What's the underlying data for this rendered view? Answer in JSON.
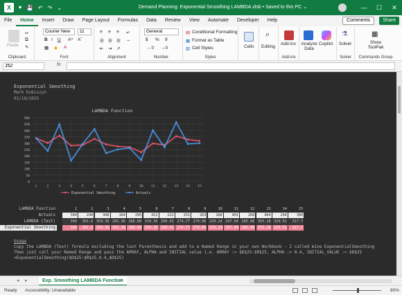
{
  "app": {
    "logo": "X",
    "title": "Demand Planning: Exponential Smoothing LAMBDA.xlsb  •  Saved to this PC",
    "title_short": "Demand Planning: Exponential Smoothing LAMBDA.xlsb • Saved to this PC ⌄"
  },
  "menu": {
    "tabs": [
      "File",
      "Home",
      "Insert",
      "Draw",
      "Page Layout",
      "Formulas",
      "Data",
      "Review",
      "View",
      "Automate",
      "Developer",
      "Help"
    ],
    "active": "Home",
    "comments_label": "Comments",
    "share_label": "Share"
  },
  "ribbon": {
    "clipboard": {
      "paste": "Paste",
      "label": "Clipboard"
    },
    "font": {
      "name": "Courier New",
      "size": "11",
      "label": "Font",
      "bold": "B",
      "italic": "I",
      "underline": "U",
      "grow": "A^",
      "shrink": "Aˇ"
    },
    "alignment": {
      "label": "Alignment"
    },
    "number": {
      "format": "General",
      "label": "Number",
      "currency": "$",
      "percent": "%",
      "comma": "9"
    },
    "styles": {
      "cond": "Conditional Formatting",
      "table": "Format as Table",
      "cell": "Cell Styles",
      "label": "Styles"
    },
    "cells": {
      "label": "Cells"
    },
    "editing": {
      "label": "Editing"
    },
    "addins": {
      "label": "Add-ins",
      "group_label": "Add-ins"
    },
    "analyze": {
      "label": "Analyze Data"
    },
    "copilot": {
      "label": "Copilot"
    },
    "solver": {
      "label": "Solver",
      "group_label": "Solver"
    },
    "toolpak": {
      "label": "Show ToolPak",
      "group_label": "Commands Group"
    }
  },
  "formula_bar": {
    "cell": "J52",
    "fx": "fx",
    "value": ""
  },
  "sheet": {
    "title": "Exponential Smoothing",
    "author": "Mark Kubiszyn",
    "date": "02/10/2025",
    "usage": {
      "heading": "Usage",
      "line1": "Copy the LAMBDA (Test) formula excluding the last Parenthesis and add to a Named Range in your own Workbook - I called mine ExponentialSmoothing",
      "line2": "Then just call your Named Range and pass the ARRAY, ALPHA and INITIAL value i.e. ARRAY := $D$25:$R$25, ALPHA := 0.4, INITIAL_VALUE := $D$25",
      "line3": "=ExponentialSmoothing($D$25:$R$25,0.4,$D$25)"
    },
    "table": {
      "header_label": "LAMBDA Function",
      "headers": [
        "1",
        "2",
        "3",
        "4",
        "5",
        "6",
        "7",
        "8",
        "9",
        "10",
        "11",
        "12",
        "13",
        "14",
        "15"
      ],
      "actuals_label": "Actuals",
      "actuals": [
        "340",
        "240",
        "448",
        "164",
        "295",
        "411",
        "222",
        "251",
        "263",
        "168",
        "401",
        "268",
        "464",
        "294",
        "300"
      ],
      "lambda_label": "LAMBDA (Test)",
      "lambda": [
        "340",
        "301.6",
        "359.36",
        "281.36",
        "286.89",
        "334.36",
        "290.41",
        "274.77",
        "270.06",
        "229.24",
        "297.94",
        "285.96",
        "355.18",
        "329.51",
        "317.7"
      ],
      "es_label": "Exponential Smoothing",
      "es": [
        "340",
        "301.6",
        "359.36",
        "281.36",
        "286.89",
        "334.36",
        "290.41",
        "274.77",
        "270.06",
        "229.24",
        "297.94",
        "285.96",
        "355.18",
        "329.51",
        "317.7"
      ]
    }
  },
  "chart_data": {
    "type": "line",
    "title": "LAMBDA Function",
    "categories": [
      1,
      2,
      3,
      4,
      5,
      6,
      7,
      8,
      9,
      10,
      11,
      12,
      13,
      14,
      15
    ],
    "ylim": [
      0,
      500
    ],
    "yticks": [
      0,
      50,
      100,
      150,
      200,
      250,
      300,
      350,
      400,
      450,
      500
    ],
    "legend_position": "bottom",
    "grid": true,
    "series": [
      {
        "name": "Exponential Smoothing",
        "color": "#ff5c75",
        "values": [
          340,
          301.6,
          359.36,
          281.36,
          286.89,
          334.36,
          290.41,
          274.77,
          270.06,
          229.24,
          297.94,
          285.96,
          355.18,
          329.51,
          317.7
        ]
      },
      {
        "name": "Actuals",
        "color": "#4fa3ff",
        "values": [
          340,
          240,
          448,
          164,
          295,
          411,
          222,
          251,
          263,
          168,
          401,
          268,
          464,
          294,
          300
        ]
      }
    ]
  },
  "sheet_tabs": {
    "active": "Exp. Smoothing LAMBDA Function",
    "add": "+",
    "prev": "◂",
    "next": "▸"
  },
  "status": {
    "ready": "Ready",
    "accessibility": "Accessibility: Unavailable",
    "zoom": "80%"
  }
}
